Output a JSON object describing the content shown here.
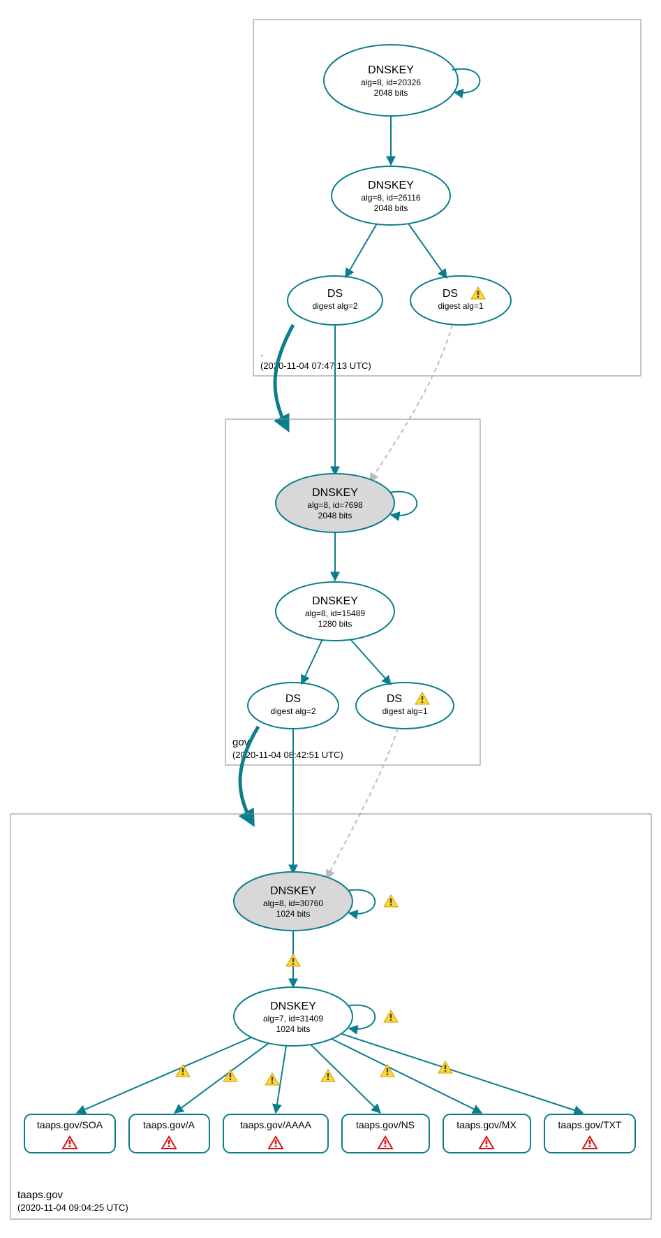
{
  "zones": {
    "root": {
      "label": ".",
      "timestamp": "(2020-11-04 07:47:13 UTC)",
      "dnskey1": {
        "name": "DNSKEY",
        "detail": "alg=8, id=20326",
        "bits": "2048 bits"
      },
      "dnskey2": {
        "name": "DNSKEY",
        "detail": "alg=8, id=26116",
        "bits": "2048 bits"
      },
      "ds1": {
        "name": "DS",
        "detail": "digest alg=2"
      },
      "ds2": {
        "name": "DS",
        "detail": "digest alg=1"
      }
    },
    "gov": {
      "label": "gov",
      "timestamp": "(2020-11-04 08:42:51 UTC)",
      "dnskey1": {
        "name": "DNSKEY",
        "detail": "alg=8, id=7698",
        "bits": "2048 bits"
      },
      "dnskey2": {
        "name": "DNSKEY",
        "detail": "alg=8, id=15489",
        "bits": "1280 bits"
      },
      "ds1": {
        "name": "DS",
        "detail": "digest alg=2"
      },
      "ds2": {
        "name": "DS",
        "detail": "digest alg=1"
      }
    },
    "taaps": {
      "label": "taaps.gov",
      "timestamp": "(2020-11-04 09:04:25 UTC)",
      "dnskey1": {
        "name": "DNSKEY",
        "detail": "alg=8, id=30760",
        "bits": "1024 bits"
      },
      "dnskey2": {
        "name": "DNSKEY",
        "detail": "alg=7, id=31409",
        "bits": "1024 bits"
      },
      "rr": {
        "soa": "taaps.gov/SOA",
        "a": "taaps.gov/A",
        "aaaa": "taaps.gov/AAAA",
        "ns": "taaps.gov/NS",
        "mx": "taaps.gov/MX",
        "txt": "taaps.gov/TXT"
      }
    }
  }
}
